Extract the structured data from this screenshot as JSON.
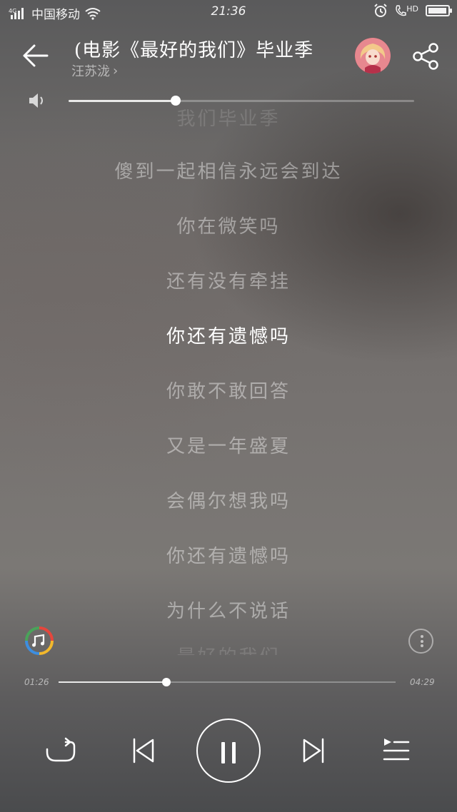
{
  "status_bar": {
    "network": "4G",
    "carrier": "中国移动",
    "time": "21:36",
    "hd_label": "HD",
    "battery_level": 0.95
  },
  "header": {
    "title": "(电影《最好的我们》毕业季",
    "artist": "汪苏泷",
    "artist_chevron": "›"
  },
  "volume": {
    "level": 0.31
  },
  "lyrics": {
    "lines": [
      "我们毕业季",
      "傻到一起相信永远会到达",
      "你在微笑吗",
      "还有没有牵挂",
      "你还有遗憾吗",
      "你敢不敢回答",
      "又是一年盛夏",
      "会偶尔想我吗",
      "你还有遗憾吗",
      "为什么不说话",
      "最好的我们"
    ],
    "current_index": 4
  },
  "player": {
    "elapsed": "01:26",
    "total": "04:29",
    "progress": 0.32
  },
  "icons": {
    "back": "arrow-left-icon",
    "share": "share-icon",
    "volume": "speaker-icon",
    "more": "more-vertical-icon",
    "repeat": "repeat-icon",
    "previous": "skip-previous-icon",
    "pause": "pause-icon",
    "next": "skip-next-icon",
    "playlist": "playlist-icon"
  }
}
